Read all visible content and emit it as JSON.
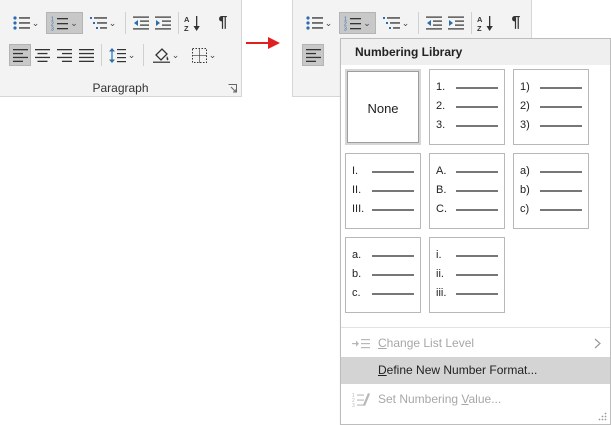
{
  "ribbon": {
    "group_label": "Paragraph",
    "icons": {
      "bullets": "bullets-icon",
      "numbering": "numbering-icon",
      "multilevel": "multilevel-list-icon",
      "decrease_indent": "decrease-indent-icon",
      "increase_indent": "increase-indent-icon",
      "sort": "sort-az-icon",
      "show_marks": "pilcrow-icon",
      "align_left": "align-left-icon",
      "center": "align-center-icon",
      "align_right": "align-right-icon",
      "justify": "justify-icon",
      "line_spacing": "line-spacing-icon",
      "shading": "shading-icon",
      "borders": "borders-icon"
    },
    "pilcrow": "¶",
    "dropdown_glyph": "⌄"
  },
  "menu": {
    "heading": "Numbering Library",
    "tiles": [
      {
        "name": "none",
        "label": "None",
        "markers": []
      },
      {
        "name": "numeric-dot",
        "markers": [
          "1.",
          "2.",
          "3."
        ]
      },
      {
        "name": "numeric-paren",
        "markers": [
          "1)",
          "2)",
          "3)"
        ]
      },
      {
        "name": "roman-upper",
        "markers": [
          "I.",
          "II.",
          "III."
        ]
      },
      {
        "name": "alpha-upper",
        "markers": [
          "A.",
          "B.",
          "C."
        ]
      },
      {
        "name": "alpha-lower-paren",
        "markers": [
          "a)",
          "b)",
          "c)"
        ]
      },
      {
        "name": "alpha-lower-dot",
        "markers": [
          "a.",
          "b.",
          "c."
        ]
      },
      {
        "name": "roman-lower",
        "markers": [
          "i.",
          "ii.",
          "iii."
        ]
      }
    ],
    "items": [
      {
        "name": "change-list-level",
        "label": "Change List Level",
        "underline": "C",
        "rest": "hange List Level",
        "disabled": true,
        "submenu": true,
        "icon": "change-list-level-icon"
      },
      {
        "name": "define-new-number-format",
        "label": "Define New Number Format...",
        "underline": "D",
        "rest": "efine New Number Format...",
        "disabled": false,
        "hover": true,
        "icon": ""
      },
      {
        "name": "set-numbering-value",
        "label": "Set Numbering Value...",
        "underline": "V",
        "pre": "Set Numbering ",
        "rest": "alue...",
        "disabled": true,
        "icon": "set-numbering-value-icon"
      }
    ]
  },
  "colors": {
    "ribbon_bg": "#f3f3f3",
    "selected_bg": "#c8c8c8",
    "arrow": "#e02020",
    "hover_item": "#d4d4d4",
    "disabled_text": "#a7a7a7"
  }
}
